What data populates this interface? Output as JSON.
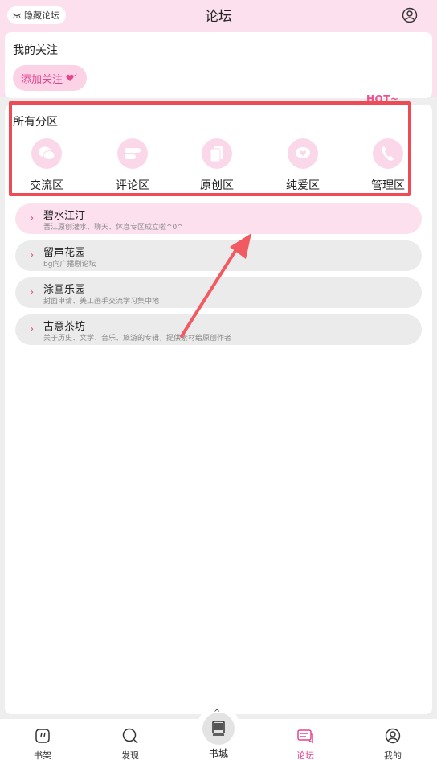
{
  "header": {
    "hide_button": "隐藏论坛",
    "title": "论坛"
  },
  "follow": {
    "title": "我的关注",
    "add_button": "添加关注"
  },
  "sections": {
    "title": "所有分区",
    "items": [
      {
        "label": "交流区",
        "icon": "chat-bubbles-icon"
      },
      {
        "label": "评论区",
        "icon": "comment-icon"
      },
      {
        "label": "原创区",
        "icon": "documents-icon"
      },
      {
        "label": "纯爱区",
        "icon": "heart-bubble-icon"
      },
      {
        "label": "管理区",
        "icon": "phone-icon"
      }
    ],
    "hot_badge": "HOT~"
  },
  "forums": [
    {
      "name": "碧水江汀",
      "desc": "晋江原创灌水、聊天、休息专区成立啦^0^"
    },
    {
      "name": "留声花园",
      "desc": "bg向广播剧论坛"
    },
    {
      "name": "涂画乐园",
      "desc": "封面申请、美工画手交流学习集中地"
    },
    {
      "name": "古意茶坊",
      "desc": "关于历史、文学、音乐、旅游的专辑，提供素材给原创作者"
    }
  ],
  "tabbar": {
    "items": [
      {
        "label": "书架",
        "icon": "bookshelf-icon"
      },
      {
        "label": "发现",
        "icon": "search-icon"
      },
      {
        "label": "书城",
        "icon": "book-icon"
      },
      {
        "label": "论坛",
        "icon": "forum-icon",
        "active": true
      },
      {
        "label": "我的",
        "icon": "user-icon"
      }
    ]
  },
  "colors": {
    "accent": "#e5448e",
    "header_bg": "#fde0ee",
    "highlight": "#ee4b55"
  }
}
